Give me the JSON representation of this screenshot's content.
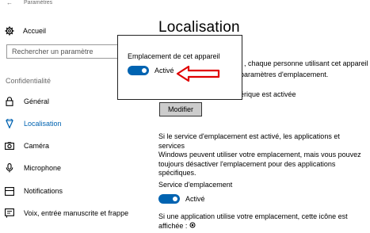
{
  "window": {
    "app_title": "Paramètres"
  },
  "sidebar": {
    "home_label": "Accueil",
    "search_placeholder": "Rechercher un paramètre",
    "section_header": "Confidentialité",
    "items": [
      {
        "label": "Général",
        "icon": "lock-icon"
      },
      {
        "label": "Localisation",
        "icon": "location-icon",
        "active": true
      },
      {
        "label": "Caméra",
        "icon": "camera-icon"
      },
      {
        "label": "Microphone",
        "icon": "microphone-icon"
      },
      {
        "label": "Notifications",
        "icon": "notifications-icon"
      },
      {
        "label": "Voix, entrée manuscrite et frappe",
        "icon": "voice-icon"
      }
    ]
  },
  "main": {
    "title": "Localisation",
    "partial_line_1": ", chaque personne utilisant cet appareil",
    "partial_line_2": "paramètres d'emplacement.",
    "partial_line_3": "érique est activée",
    "modify_button": "Modifier",
    "service_paragraph": [
      "Si le service d'emplacement est activé, les applications et services",
      "Windows peuvent utiliser votre emplacement, mais vous pouvez",
      "toujours désactiver l'emplacement pour des applications",
      "spécifiques."
    ],
    "service_heading": "Service d'emplacement",
    "service_toggle_state": "Activé",
    "app_icon_paragraph": [
      "Si une application utilise votre emplacement, cette icône est",
      "affichée :"
    ]
  },
  "popup": {
    "title": "Emplacement de cet appareil",
    "toggle_state": "Activé"
  },
  "colors": {
    "accent": "#0063b1",
    "annotation_arrow": "#e00000"
  }
}
